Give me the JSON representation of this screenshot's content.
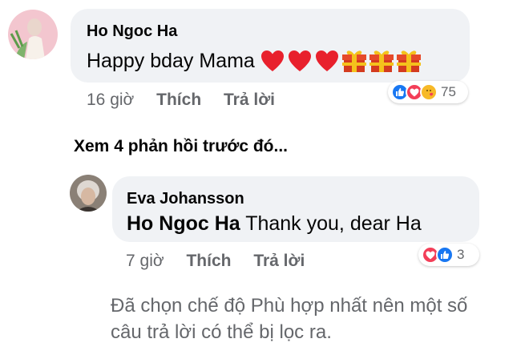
{
  "comment1": {
    "author": "Ho Ngoc Ha",
    "text": "Happy bday Mama",
    "emojis": [
      "heart-emoji",
      "heart-emoji",
      "heart-emoji",
      "gift-emoji",
      "gift-emoji",
      "gift-emoji"
    ],
    "time": "16 giờ",
    "like_label": "Thích",
    "reply_label": "Trả lời",
    "reaction_icons": [
      "like-reaction",
      "love-reaction",
      "care-reaction"
    ],
    "reaction_count": "75"
  },
  "view_previous": "Xem 4 phản hồi trước đó...",
  "reply1": {
    "author": "Eva Johansson",
    "mention": "Ho Ngoc Ha",
    "text": "Thank you, dear Ha",
    "time": "7 giờ",
    "like_label": "Thích",
    "reply_label": "Trả lời",
    "reaction_icons": [
      "love-reaction",
      "like-reaction"
    ],
    "reaction_count": "3"
  },
  "filter_note": {
    "line1": "Đã chọn chế độ Phù hợp nhất nên một số",
    "line2": "câu trả lời có thể bị lọc ra."
  },
  "colors": {
    "like": "#1877f2",
    "love": "#f33e58",
    "care": "#f7b928",
    "meta": "#65676b",
    "bubble": "#f0f2f5"
  }
}
